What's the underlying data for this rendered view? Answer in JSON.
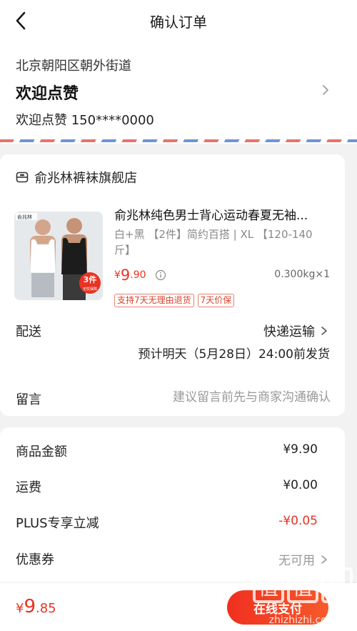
{
  "header": {
    "title": "确认订单",
    "back_icon": "chevron-left-icon"
  },
  "address": {
    "region": "北京朝阳区朝外街道",
    "name": "欢迎点赞",
    "phone": "欢迎点赞 150****0000",
    "arrow_icon": "chevron-right-icon"
  },
  "shop": {
    "icon": "shop-icon",
    "name": "俞兆林裤袜旗舰店"
  },
  "product": {
    "title": "俞兆林纯色男士背心运动春夏无袖...",
    "spec": "白+黑 【2件】简约百搭 | XL 【120-140斤】",
    "price_symbol": "¥",
    "price_int": "9",
    "price_dec": ".90",
    "weight_qty": "0.300kg×1",
    "image_badge": "3件",
    "image_badge_sub": "无忧保障",
    "brand_mark": "俞兆林",
    "tags": [
      "支持7天无理由退货",
      "7天价保"
    ]
  },
  "delivery": {
    "label": "配送",
    "method": "快递运输",
    "eta": "预计明天（5月28日）24:00前发货"
  },
  "remark": {
    "label": "留言",
    "placeholder": "建议留言前先与商家沟通确认"
  },
  "summary": {
    "goods_label": "商品金额",
    "goods_value": "¥9.90",
    "shipping_label": "运费",
    "shipping_value": "¥0.00",
    "plus_label": "PLUS专享立减",
    "plus_value": "-¥0.05",
    "coupon_label": "优惠券",
    "coupon_value": "无可用"
  },
  "footer": {
    "total_symbol": "¥",
    "total_int": "9",
    "total_dec": ".85",
    "pay_label": "在线支付"
  },
  "watermark": {
    "glyph": "值",
    "text": "zhizhizhi.com"
  },
  "colors": {
    "accent": "#e93323",
    "airmail_red": "#e8726b",
    "airmail_blue": "#6f93d8",
    "background": "#f2f2f2"
  }
}
